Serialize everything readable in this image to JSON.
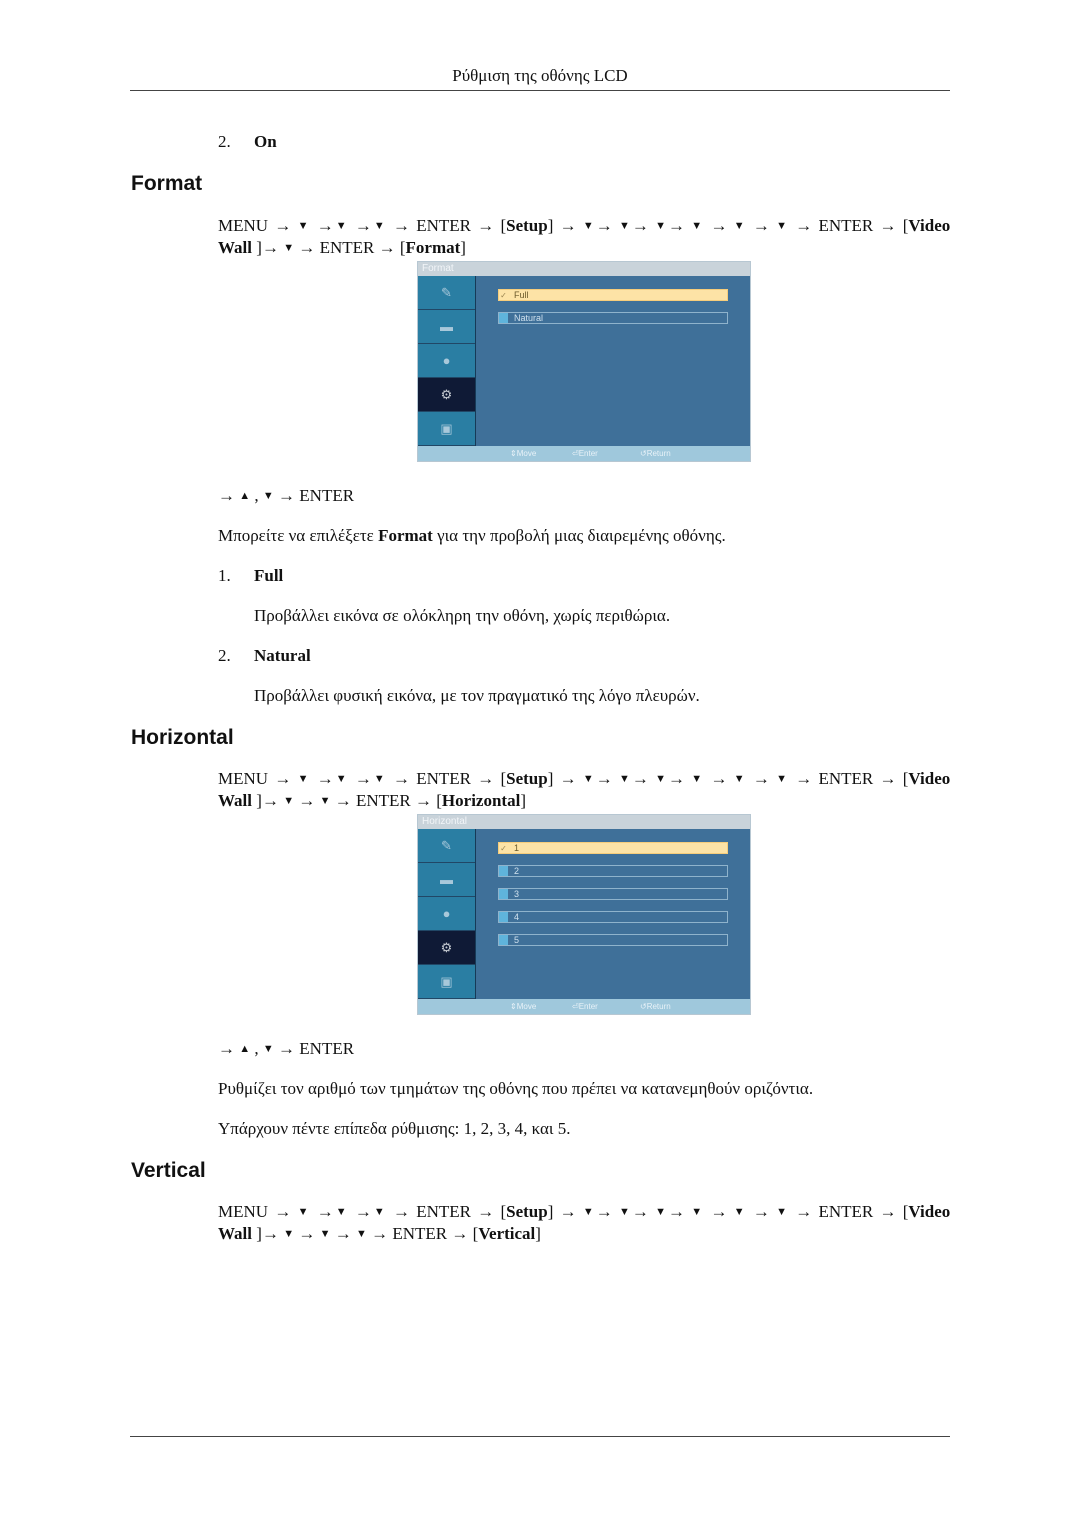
{
  "header": {
    "title": "Ρύθμιση της οθόνης LCD"
  },
  "top_item": {
    "number": "2.",
    "label": "On"
  },
  "nav_common": {
    "menu": "MENU",
    "arrow": "→",
    "down": "▼",
    "up": "▲",
    "enter": "ENTER",
    "setup": "Setup",
    "video": "Video",
    "wall": "Wall"
  },
  "sections": {
    "format": {
      "heading": "Format",
      "target": "Format",
      "osd": {
        "title": "Format",
        "options": [
          "Full",
          "Natural"
        ],
        "selected": "Full",
        "footer": {
          "move": "Move",
          "enter": "Enter",
          "return": "Return"
        }
      },
      "select_hint_end": "ENTER",
      "description_pre": "Μπορείτε να επιλέξετε ",
      "description_bold": "Format",
      "description_post": " για την προβολή μιας διαιρεμένης οθόνης.",
      "items": [
        {
          "number": "1.",
          "label": "Full",
          "text": "Προβάλλει εικόνα σε ολόκληρη την οθόνη, χωρίς περιθώρια."
        },
        {
          "number": "2.",
          "label": "Natural",
          "text": "Προβάλλει φυσική εικόνα, με τον πραγματικό της λόγο πλευρών."
        }
      ]
    },
    "horizontal": {
      "heading": "Horizontal",
      "target": "Horizontal",
      "osd": {
        "title": "Horizontal",
        "options": [
          "1",
          "2",
          "3",
          "4",
          "5"
        ],
        "selected": "1",
        "footer": {
          "move": "Move",
          "enter": "Enter",
          "return": "Return"
        }
      },
      "select_hint_end": "ENTER",
      "description": "Ρυθμίζει τον αριθμό των τμημάτων της οθόνης που πρέπει να κατανεμηθούν οριζόντια.",
      "levels": "Υπάρχουν πέντε επίπεδα ρύθμισης: 1, 2, 3, 4, και 5."
    },
    "vertical": {
      "heading": "Vertical",
      "target": "Vertical"
    }
  }
}
